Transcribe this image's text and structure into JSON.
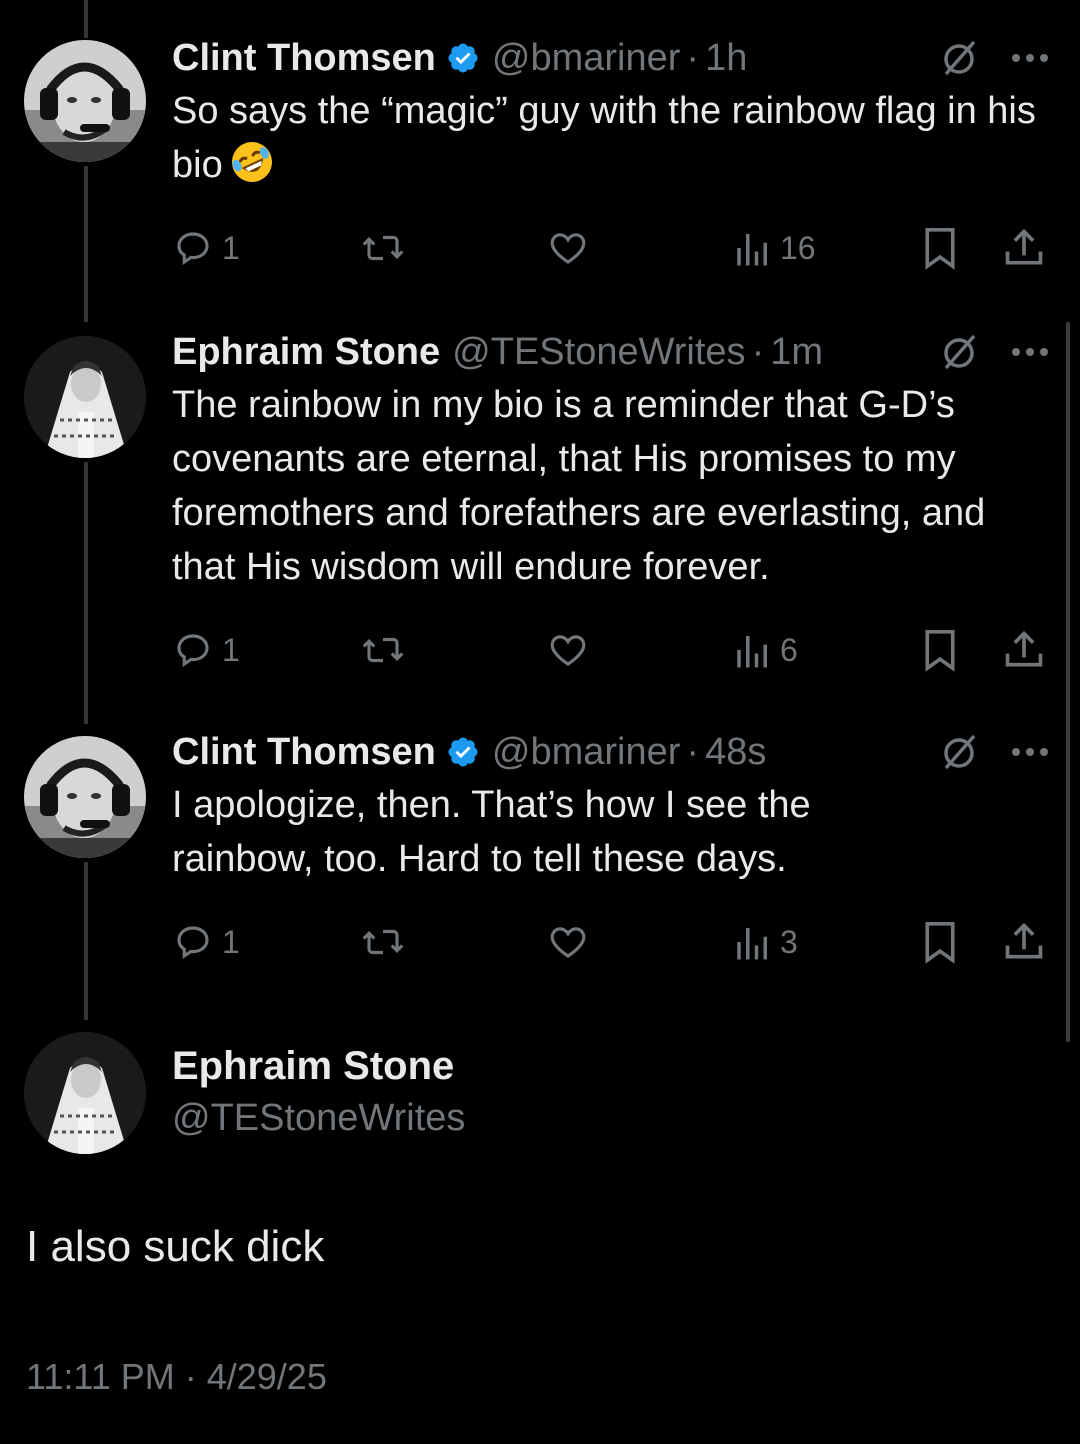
{
  "thread": [
    {
      "name": "Clint Thomsen",
      "verified": true,
      "handle": "@bmariner",
      "time": "1h",
      "text": "So says the “magic” guy with the rainbow flag in his bio",
      "emoji": "rolling-on-floor-laughing-emoji",
      "replies": "1",
      "views": "16"
    },
    {
      "name": "Ephraim Stone",
      "verified": false,
      "handle": "@TEStoneWrites",
      "time": "1m",
      "text": "The rainbow in my bio is a reminder that G-D’s covenants are eternal, that His promises to my foremothers and forefathers are everlasting, and that His wisdom will endure forever.",
      "replies": "1",
      "views": "6"
    },
    {
      "name": "Clint Thomsen",
      "verified": true,
      "handle": "@bmariner",
      "time": "48s",
      "text": "I apologize, then. That’s how I see the rainbow, too. Hard to tell these days.",
      "replies": "1",
      "views": "3"
    }
  ],
  "main_post": {
    "name": "Ephraim Stone",
    "handle": "@TEStoneWrites",
    "text": "I also suck dick",
    "timestamp": "11:11 PM · 4/29/25"
  },
  "separator": "·",
  "colors": {
    "background": "#000000",
    "text": "#e7e9ea",
    "secondary": "#71767b",
    "verified": "#1d9bf0",
    "thread_line": "#333639"
  }
}
